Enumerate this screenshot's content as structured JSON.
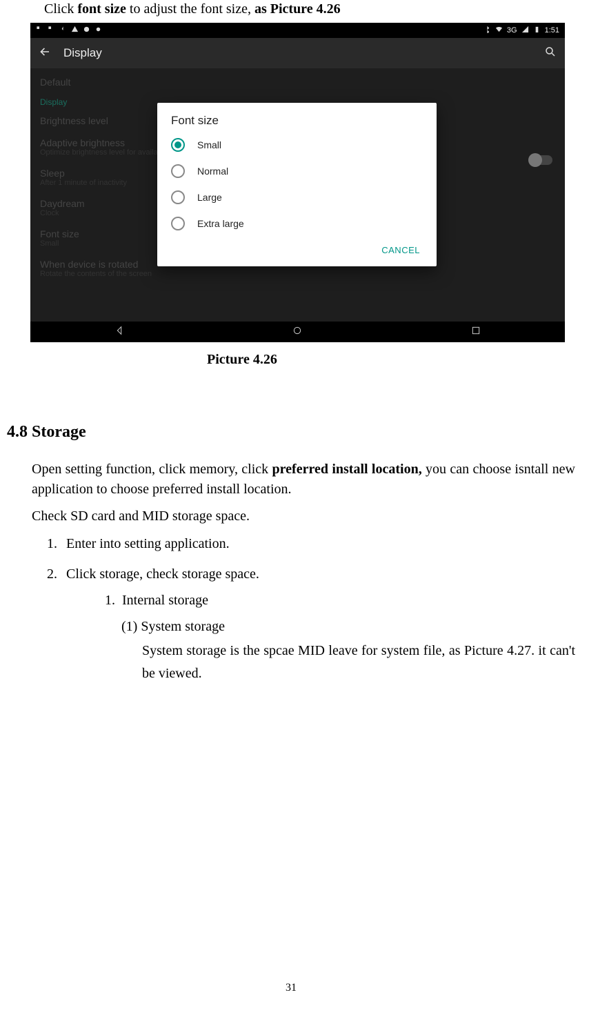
{
  "intro": {
    "prefix": "Click ",
    "bold1": "font size",
    "mid": " to adjust the font size, ",
    "bold2": "as Picture 4.26"
  },
  "statusbar": {
    "time": "1:51",
    "network": "3G"
  },
  "appbar": {
    "title": "Display"
  },
  "settings": {
    "row0": "Default",
    "section": "Display",
    "row1": "Brightness level",
    "row2t": "Adaptive brightness",
    "row2s": "Optimize brightness level for available light",
    "row3t": "Sleep",
    "row3s": "After 1 minute of inactivity",
    "row4t": "Daydream",
    "row4s": "Clock",
    "row5t": "Font size",
    "row5s": "Small",
    "row6t": "When device is rotated",
    "row6s": "Rotate the contents of the screen"
  },
  "dialog": {
    "title": "Font size",
    "opt1": "Small",
    "opt2": "Normal",
    "opt3": "Large",
    "opt4": "Extra large",
    "cancel": "CANCEL"
  },
  "caption": "Picture 4.26",
  "heading": "4.8 Storage",
  "para1a": "Open setting function, click memory, click ",
  "para1b": "preferred install location,",
  "para1c": " you can choose isntall new application to choose preferred install location.",
  "para2": "Check SD card and MID storage space.",
  "li1": "Enter into setting application.",
  "li2": "Click storage, check storage space.",
  "sub1": "Internal storage",
  "sub2": "(1) System storage",
  "sub3": "System storage is the spcae MID leave for system file, as Picture 4.27. it can't be viewed.",
  "page_number": "31"
}
